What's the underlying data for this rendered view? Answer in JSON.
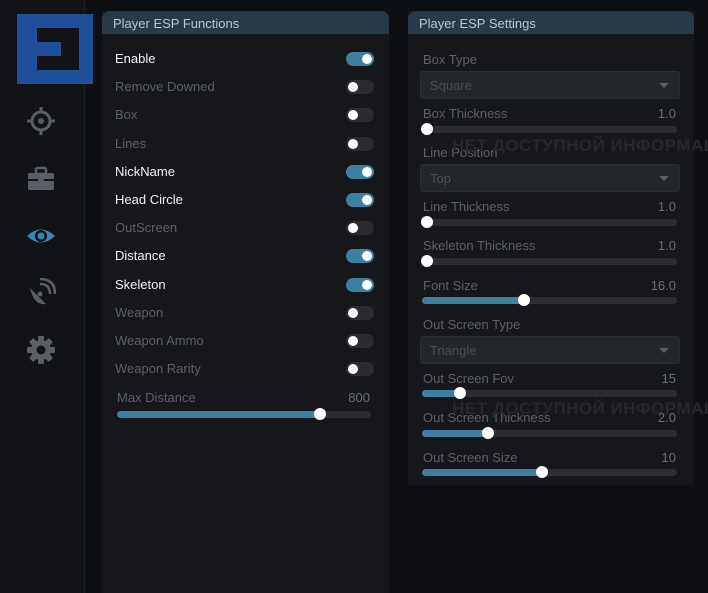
{
  "sidebar": {
    "logo_icon": "logo-e",
    "items": [
      {
        "name": "aim",
        "icon": "crosshair-icon",
        "active": false
      },
      {
        "name": "items",
        "icon": "toolbox-icon",
        "active": false
      },
      {
        "name": "visuals",
        "icon": "eye-icon",
        "active": true
      },
      {
        "name": "radar",
        "icon": "radar-icon",
        "active": false
      },
      {
        "name": "settings",
        "icon": "gear-icon",
        "active": false
      }
    ],
    "active_color": "#3a86b0",
    "inactive_color": "#5b5e64"
  },
  "functions": {
    "title": "Player ESP Functions",
    "toggles": [
      {
        "label": "Enable",
        "on": true
      },
      {
        "label": "Remove Downed",
        "on": false
      },
      {
        "label": "Box",
        "on": false
      },
      {
        "label": "Lines",
        "on": false
      },
      {
        "label": "NickName",
        "on": true
      },
      {
        "label": "Head Circle",
        "on": true
      },
      {
        "label": "OutScreen",
        "on": false
      },
      {
        "label": "Distance",
        "on": true
      },
      {
        "label": "Skeleton",
        "on": true
      },
      {
        "label": "Weapon",
        "on": false
      },
      {
        "label": "Weapon Ammo",
        "on": false
      },
      {
        "label": "Weapon Rarity",
        "on": false
      }
    ],
    "max_distance": {
      "label": "Max Distance",
      "value": "800",
      "fraction": 0.8
    }
  },
  "settings": {
    "title": "Player ESP Settings",
    "box_type": {
      "label": "Box Type",
      "value": "Square"
    },
    "box_thickness": {
      "label": "Box Thickness",
      "value": "1.0",
      "fraction": 0.0
    },
    "line_position": {
      "label": "Line Position",
      "value": "Top"
    },
    "line_thickness": {
      "label": "Line Thickness",
      "value": "1.0",
      "fraction": 0.0
    },
    "skeleton_thickness": {
      "label": "Skeleton Thickness",
      "value": "1.0",
      "fraction": 0.0
    },
    "font_size": {
      "label": "Font Size",
      "value": "16.0",
      "fraction": 0.4
    },
    "out_screen_type": {
      "label": "Out Screen Type",
      "value": "Triangle"
    },
    "out_screen_fov": {
      "label": "Out Screen Fov",
      "value": "15",
      "fraction": 0.15
    },
    "out_screen_thickness": {
      "label": "Out Screen Thickness",
      "value": "2.0",
      "fraction": 0.26
    },
    "out_screen_size": {
      "label": "Out Screen Size",
      "value": "10",
      "fraction": 0.47
    }
  },
  "watermark": {
    "text": "НЕТ ДОСТУПНОЙ ИНФОРМАЦИИ"
  },
  "accent_color": "#3f7f9f"
}
